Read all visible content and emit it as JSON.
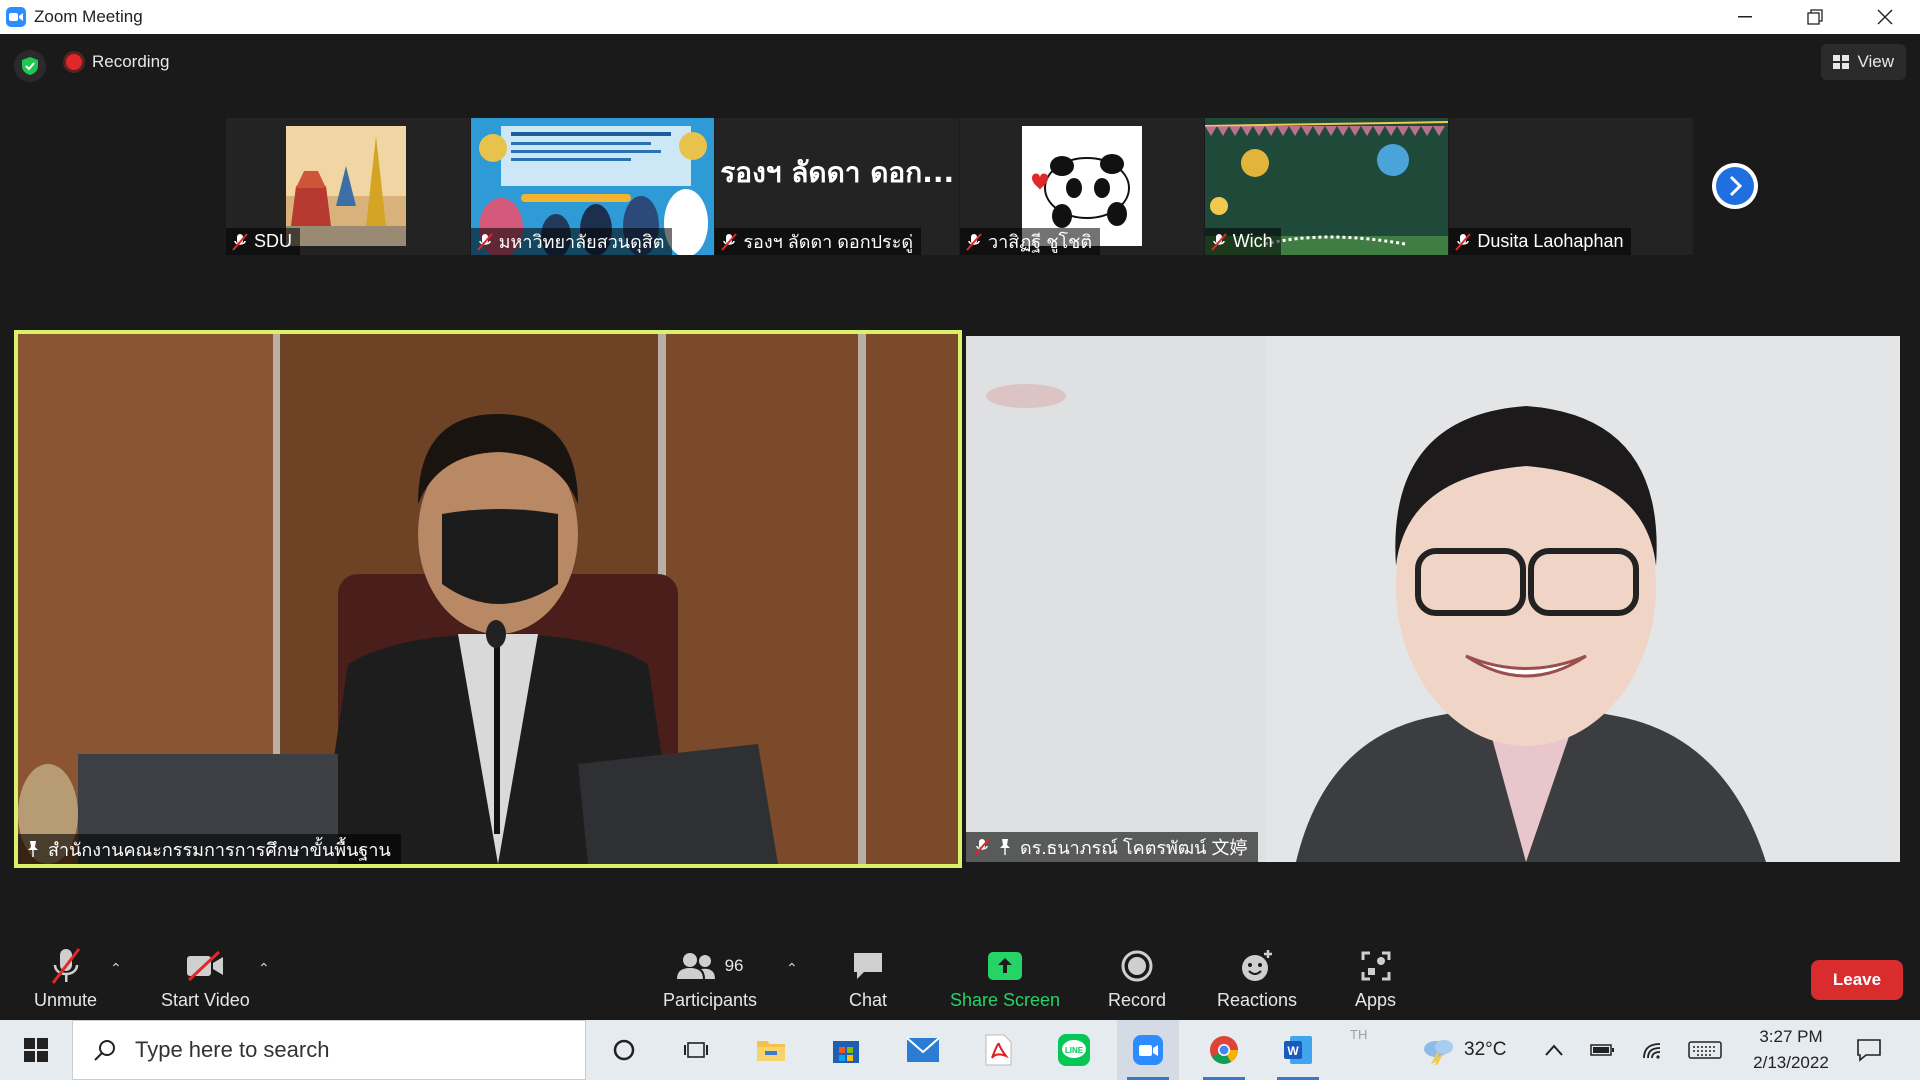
{
  "window": {
    "title": "Zoom Meeting"
  },
  "status": {
    "recording_label": "Recording",
    "view_label": "View"
  },
  "thumbnails": [
    {
      "name": "SDU",
      "big_name": ""
    },
    {
      "name": "มหาวิทยาลัยสวนดุสิต",
      "big_name": ""
    },
    {
      "name": "รองฯ ลัดดา ดอกประดู่",
      "big_name": "รองฯ ลัดดา ดอก..."
    },
    {
      "name": "วาสิฏฐี ชูโชติ",
      "big_name": ""
    },
    {
      "name": "Wich",
      "big_name": ""
    },
    {
      "name": "Dusita Laohaphan",
      "big_name": ""
    }
  ],
  "videos": {
    "left": {
      "name": "สำนักงานคณะกรรมการการศึกษาขั้นพื้นฐาน"
    },
    "right": {
      "name": "ดร.ธนาภรณ์ โคตรพัฒน์ 文婷"
    }
  },
  "toolbar": {
    "unmute": "Unmute",
    "start_video": "Start Video",
    "participants": "Participants",
    "participants_count": "96",
    "chat": "Chat",
    "share_screen": "Share Screen",
    "record": "Record",
    "reactions": "Reactions",
    "apps": "Apps",
    "leave": "Leave"
  },
  "taskbar": {
    "search_placeholder": "Type here to search",
    "ime": "TH",
    "temperature": "32°C",
    "time": "3:27 PM",
    "date": "2/13/2022"
  },
  "colors": {
    "active_speaker_border": "#d9f26a",
    "share_screen_green": "#25d366",
    "leave_red": "#d92c2c",
    "next_blue": "#1f6fe0"
  }
}
